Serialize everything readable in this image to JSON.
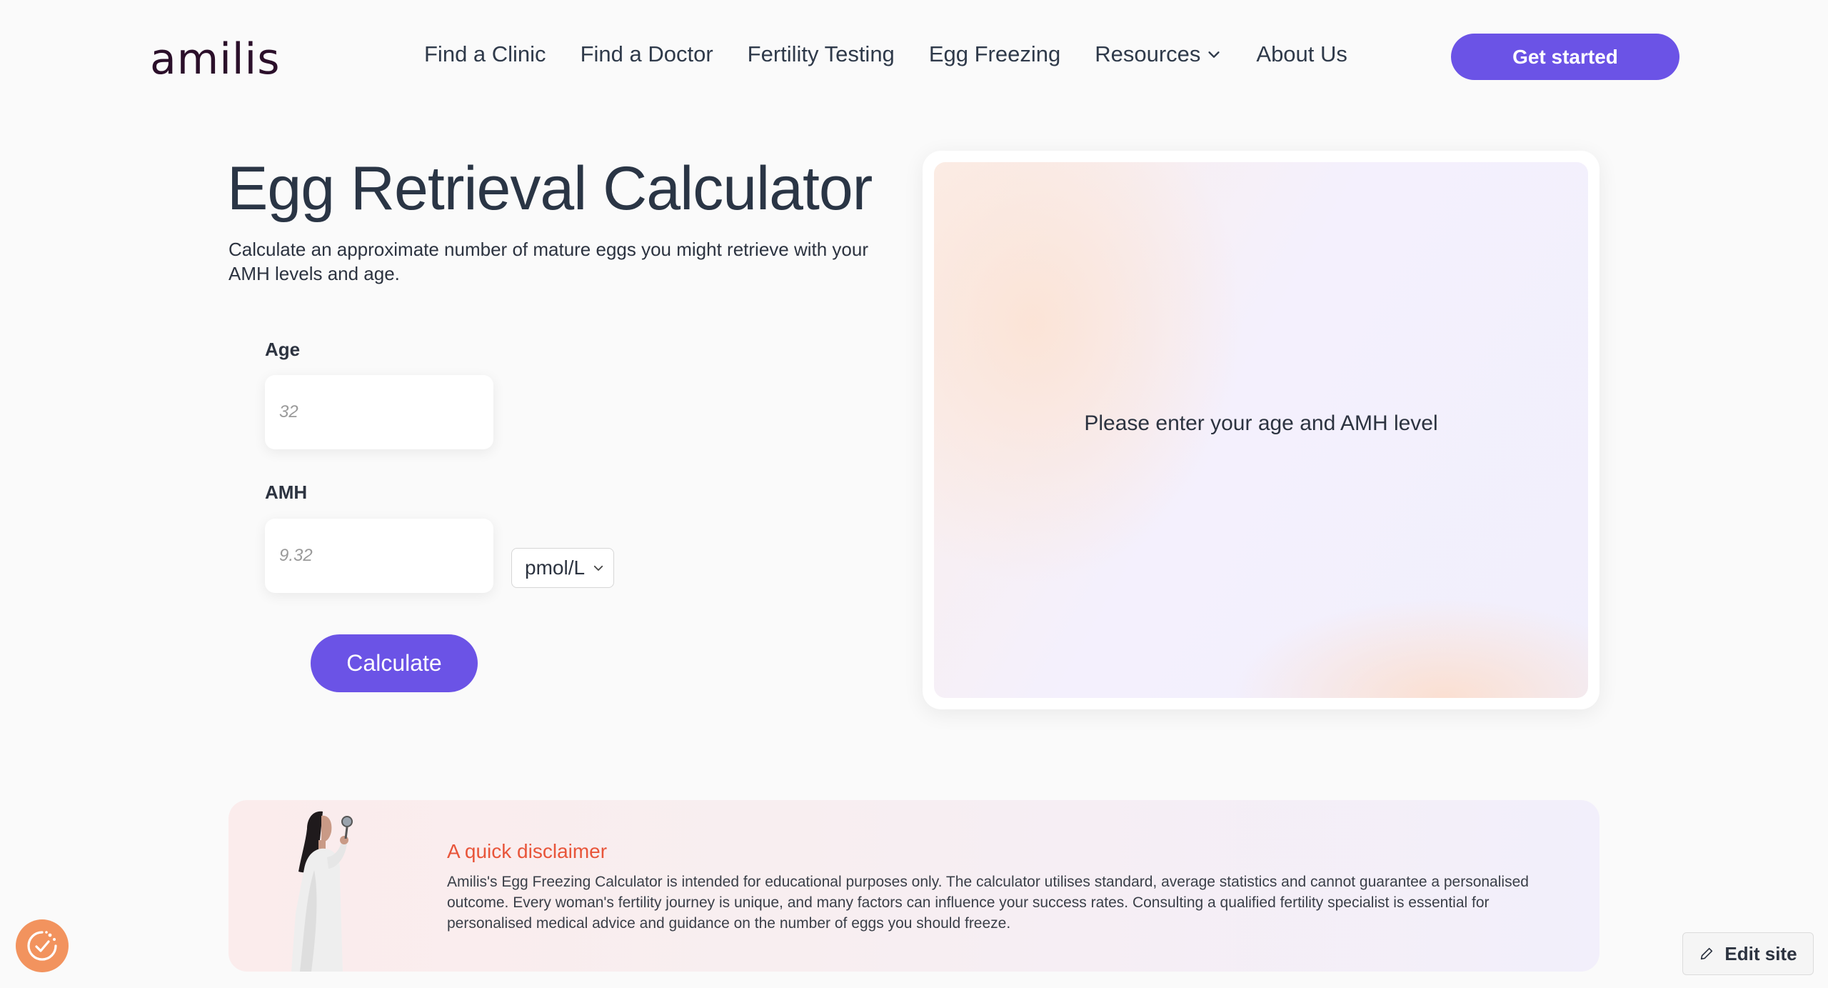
{
  "brand": {
    "logo_text": "amilis",
    "accent_color": "#6b53e6",
    "disclaimer_color": "#e8553a"
  },
  "nav": {
    "items": [
      {
        "label": "Find a Clinic"
      },
      {
        "label": "Find a Doctor"
      },
      {
        "label": "Fertility Testing"
      },
      {
        "label": "Egg Freezing"
      },
      {
        "label": "Resources",
        "icon": "chevron-down-icon"
      },
      {
        "label": "About Us"
      }
    ],
    "cta_label": "Get started"
  },
  "calculator": {
    "title": "Egg Retrieval Calculator",
    "subtitle": "Calculate an approximate number of mature eggs you might retrieve with your AMH levels and age.",
    "age": {
      "label": "Age",
      "placeholder": "32",
      "value": ""
    },
    "amh": {
      "label": "AMH",
      "placeholder": "9.32",
      "value": ""
    },
    "unit": {
      "selected": "pmol/L",
      "icon": "chevron-down-icon"
    },
    "calculate_label": "Calculate"
  },
  "result": {
    "message": "Please enter your age and AMH level"
  },
  "disclaimer": {
    "title": "A quick disclaimer",
    "body": "Amilis's Egg Freezing Calculator is intended for educational purposes only. The calculator utilises standard, average statistics and cannot guarantee a personalised outcome. Every woman's fertility journey is unique, and many factors can influence your success rates. Consulting a qualified fertility specialist is essential for personalised medical advice and guidance on the number of eggs you should freeze."
  },
  "widgets": {
    "cookie_icon": "cookie-consent-icon",
    "edit_site_label": "Edit site",
    "edit_icon": "pencil-icon"
  }
}
